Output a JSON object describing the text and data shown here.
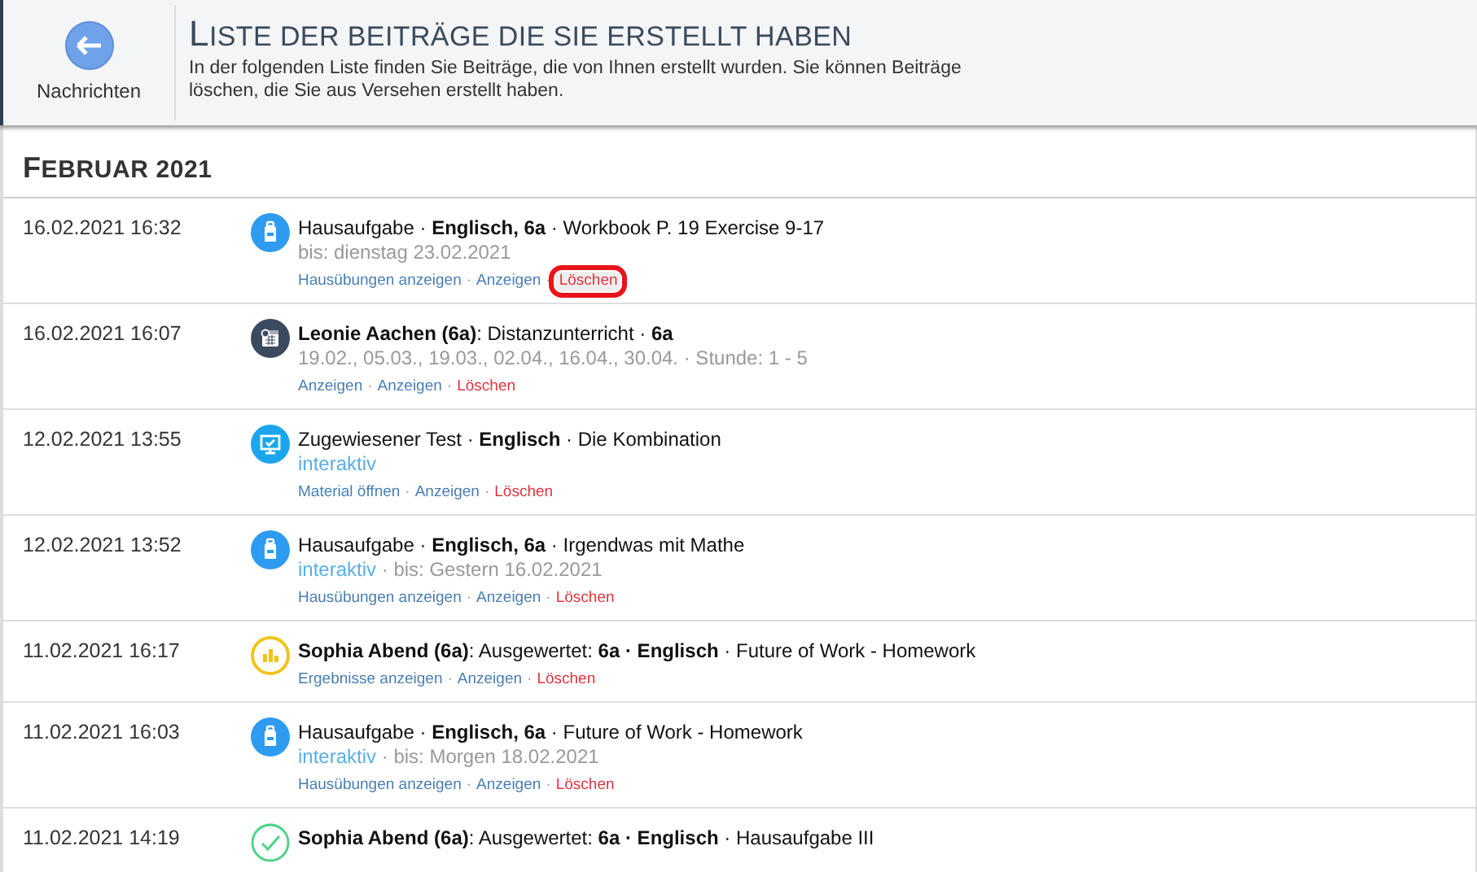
{
  "header": {
    "back_label": "Nachrichten",
    "title": "LISTE DER BEITRÄGE DIE SIE ERSTELLT HABEN",
    "description": "In der folgenden Liste finden Sie Beiträge, die von Ihnen erstellt wurden. Sie können Beiträge löschen, die Sie aus Versehen erstellt haben."
  },
  "section": {
    "heading": "FEBRUAR 2021"
  },
  "entries": [
    {
      "date": "16.02.2021 16:32",
      "kind": "homework",
      "title": "Hausaufgabe · **Englisch, 6a** · Workbook P. 19 Exercise 9-17",
      "subtitle": [
        {
          "kind": "plain",
          "text": "bis: dienstag 23.02.2021"
        }
      ],
      "actions": [
        {
          "kind": "link",
          "text": "Hausübungen anzeigen",
          "highlighted": false
        },
        {
          "kind": "separator",
          "text": "·",
          "highlighted": false
        },
        {
          "kind": "link",
          "text": "Anzeigen",
          "highlighted": false
        },
        {
          "kind": "separator",
          "text": "·",
          "highlighted": false
        },
        {
          "kind": "delete",
          "text": "Löschen",
          "highlighted": true
        }
      ]
    },
    {
      "date": "16.02.2021 16:07",
      "kind": "timetable",
      "title": "**Leonie Aachen (6a)**: Distanzunterricht · **6a**",
      "subtitle": [
        {
          "kind": "plain",
          "text": "19.02., 05.03., 19.03., 02.04., 16.04., 30.04. · Stunde: 1 - 5"
        }
      ],
      "actions": [
        {
          "kind": "link",
          "text": "Anzeigen",
          "highlighted": false
        },
        {
          "kind": "separator",
          "text": "·",
          "highlighted": false
        },
        {
          "kind": "link",
          "text": "Anzeigen",
          "highlighted": false
        },
        {
          "kind": "separator",
          "text": "·",
          "highlighted": false
        },
        {
          "kind": "delete",
          "text": "Löschen",
          "highlighted": false
        }
      ]
    },
    {
      "date": "12.02.2021 13:55",
      "kind": "test",
      "title": "Zugewiesener Test · **Englisch** · Die Kombination",
      "subtitle": [
        {
          "kind": "tag",
          "text": "interaktiv"
        }
      ],
      "actions": [
        {
          "kind": "link",
          "text": "Material öffnen",
          "highlighted": false
        },
        {
          "kind": "separator",
          "text": "·",
          "highlighted": false
        },
        {
          "kind": "link",
          "text": "Anzeigen",
          "highlighted": false
        },
        {
          "kind": "separator",
          "text": "·",
          "highlighted": false
        },
        {
          "kind": "delete",
          "text": "Löschen",
          "highlighted": false
        }
      ]
    },
    {
      "date": "12.02.2021 13:52",
      "kind": "homework",
      "title": "Hausaufgabe · **Englisch, 6a** · Irgendwas mit Mathe",
      "subtitle": [
        {
          "kind": "tag",
          "text": "interaktiv"
        },
        {
          "kind": "plain",
          "text": "· bis: Gestern 16.02.2021"
        }
      ],
      "actions": [
        {
          "kind": "link",
          "text": "Hausübungen anzeigen",
          "highlighted": false
        },
        {
          "kind": "separator",
          "text": "·",
          "highlighted": false
        },
        {
          "kind": "link",
          "text": "Anzeigen",
          "highlighted": false
        },
        {
          "kind": "separator",
          "text": "·",
          "highlighted": false
        },
        {
          "kind": "delete",
          "text": "Löschen",
          "highlighted": false
        }
      ]
    },
    {
      "date": "11.02.2021 16:17",
      "kind": "results",
      "title": "**Sophia Abend (6a)**: Ausgewertet: **6a · Englisch** · Future of Work - Homework",
      "actions": [
        {
          "kind": "link",
          "text": "Ergebnisse anzeigen",
          "highlighted": false
        },
        {
          "kind": "separator",
          "text": "·",
          "highlighted": false
        },
        {
          "kind": "link",
          "text": "Anzeigen",
          "highlighted": false
        },
        {
          "kind": "separator",
          "text": "·",
          "highlighted": false
        },
        {
          "kind": "delete",
          "text": "Löschen",
          "highlighted": false
        }
      ]
    },
    {
      "date": "11.02.2021 16:03",
      "kind": "homework",
      "title": "Hausaufgabe · **Englisch, 6a** · Future of Work - Homework",
      "subtitle": [
        {
          "kind": "tag",
          "text": "interaktiv"
        },
        {
          "kind": "plain",
          "text": "· bis: Morgen 18.02.2021"
        }
      ],
      "actions": [
        {
          "kind": "link",
          "text": "Hausübungen anzeigen",
          "highlighted": false
        },
        {
          "kind": "separator",
          "text": "·",
          "highlighted": false
        },
        {
          "kind": "link",
          "text": "Anzeigen",
          "highlighted": false
        },
        {
          "kind": "separator",
          "text": "·",
          "highlighted": false
        },
        {
          "kind": "delete",
          "text": "Löschen",
          "highlighted": false
        }
      ]
    },
    {
      "date": "11.02.2021 14:19",
      "kind": "check",
      "title": "**Sophia Abend (6a)**: Ausgewertet: **6a · Englisch** · Hausaufgabe III"
    }
  ]
}
